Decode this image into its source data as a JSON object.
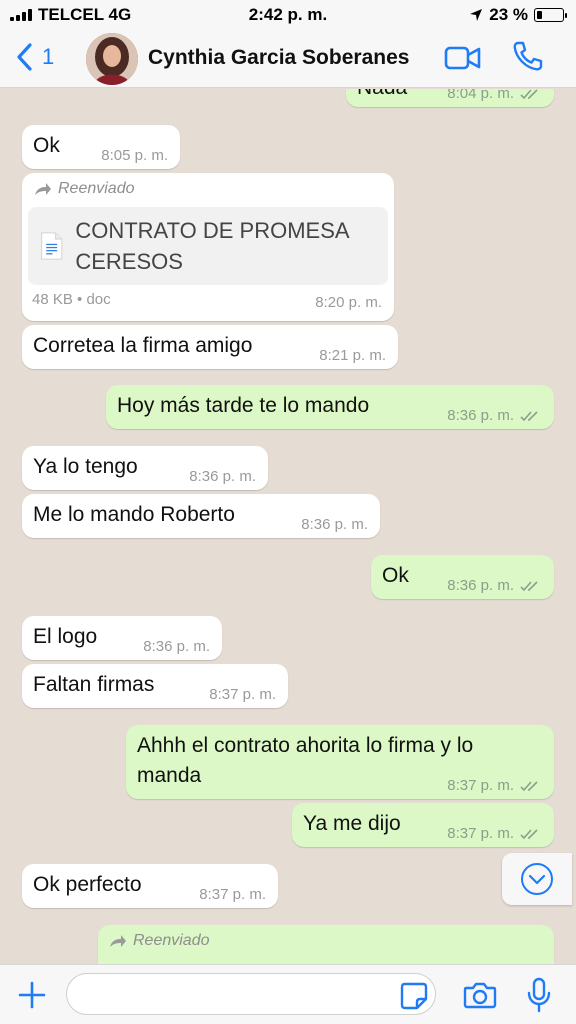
{
  "status": {
    "carrier": "TELCEL 4G",
    "time": "2:42 p. m.",
    "battery": "23 %",
    "battery_level": 0.23
  },
  "header": {
    "back_count": "1",
    "name": "Cynthia Garcia Soberanes"
  },
  "partial_top": {
    "text": "Nada",
    "time": "8:04 p. m."
  },
  "messages": [
    {
      "text": "Ok",
      "time": "8:05 p. m."
    },
    {
      "forwarded": "Reenviado",
      "doc_title": "CONTRATO DE PROMESA CERESOS",
      "doc_meta": "48 KB • doc",
      "time": "8:20 p. m."
    },
    {
      "text": "Corretea la firma amigo",
      "time": "8:21 p. m."
    },
    {
      "text": "Hoy más tarde te lo mando",
      "time": "8:36 p. m."
    },
    {
      "text": "Ya lo tengo",
      "time": "8:36 p. m."
    },
    {
      "text": "Me lo mando Roberto",
      "time": "8:36 p. m."
    },
    {
      "text": "Ok",
      "time": "8:36 p. m."
    },
    {
      "text": "El logo",
      "time": "8:36 p. m."
    },
    {
      "text": "Faltan firmas",
      "time": "8:37 p. m."
    },
    {
      "text": "Ahhh el contrato ahorita lo firma y lo manda",
      "time": "8:37 p. m."
    },
    {
      "text": "Ya me dijo",
      "time": "8:37 p. m."
    },
    {
      "text": "Ok perfecto",
      "time": "8:37 p. m."
    },
    {
      "forwarded": "Reenviado"
    }
  ],
  "input": {
    "value": "",
    "placeholder": ""
  },
  "colors": {
    "accent": "#1f7cf5",
    "incoming": "#ffffff",
    "outgoing": "#dcf8c6",
    "wallpaper": "#e5ddd4"
  }
}
